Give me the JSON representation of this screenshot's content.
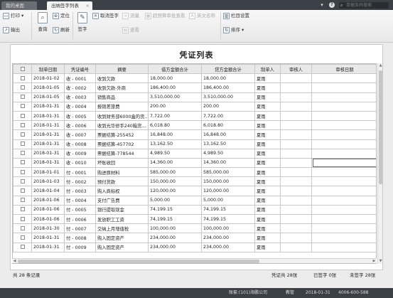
{
  "tabs": {
    "home": "我的桌面",
    "active": "出纳签字列表",
    "close": "×"
  },
  "topbar": {
    "dropdown": "▾",
    "help": "?",
    "search_placeholder": "单据条码搜索"
  },
  "toolbar": {
    "print": "打印",
    "output": "输出",
    "query": "查询",
    "locate": "定位",
    "refresh": "刷新",
    "sign": "签字",
    "cancel_sign": "取消签字",
    "flow": "流量",
    "over_budget": "超预算审批查看",
    "english_name": "英文名称",
    "view": "查看",
    "column_settings": "栏目设置",
    "sort": "排序"
  },
  "document": {
    "title": "凭证列表"
  },
  "columns": [
    "",
    "制单日期",
    "凭证编号",
    "摘要",
    "借方金额合计",
    "贷方金额合计",
    "制单人",
    "审核人",
    "审核日期"
  ],
  "rows": [
    {
      "date": "2018-01-02",
      "no": "收 - 0001",
      "summary": "收到欠款",
      "debit": "18,000.00",
      "credit": "18,000.00",
      "maker": "夏雨"
    },
    {
      "date": "2018-01-05",
      "no": "收 - 0002",
      "summary": "收到欠款-外商",
      "debit": "186,400.00",
      "credit": "186,400.00",
      "maker": "夏雨"
    },
    {
      "date": "2018-01-05",
      "no": "收 - 0003",
      "summary": "销售商品",
      "debit": "3,510,000.00",
      "credit": "3,510,000.00",
      "maker": "夏雨"
    },
    {
      "date": "2018-01-31",
      "no": "收 - 0004",
      "summary": "报销差旅费",
      "debit": "200.00",
      "credit": "200.00",
      "maker": "夏雨"
    },
    {
      "date": "2018-01-31",
      "no": "收 - 0005",
      "summary": "收到财务部6000盒的货...",
      "debit": "7,722.00",
      "credit": "7,722.00",
      "maker": "夏雨"
    },
    {
      "date": "2018-01-31",
      "no": "收 - 0006",
      "summary": "收到光华修手240箱货...",
      "debit": "6,018.80",
      "credit": "6,018.80",
      "maker": "夏雨"
    },
    {
      "date": "2018-01-31",
      "no": "收 - 0007",
      "summary": "票据结算-255452",
      "debit": "16,848.00",
      "credit": "16,848.00",
      "maker": "夏雨"
    },
    {
      "date": "2018-01-31",
      "no": "收 - 0008",
      "summary": "票据结算-457702",
      "debit": "13,162.50",
      "credit": "13,162.50",
      "maker": "夏雨"
    },
    {
      "date": "2018-01-31",
      "no": "收 - 0009",
      "summary": "票据结算-778544",
      "debit": "4,989.50",
      "credit": "4,989.50",
      "maker": "夏雨"
    },
    {
      "date": "2018-01-31",
      "no": "收 - 0010",
      "summary": "坏账收回",
      "debit": "14,360.00",
      "credit": "14,360.00",
      "maker": "夏雨"
    },
    {
      "date": "2018-01-01",
      "no": "付 - 0001",
      "summary": "购进原材料",
      "debit": "585,000.00",
      "credit": "585,000.00",
      "maker": "夏雨"
    },
    {
      "date": "2018-01-03",
      "no": "付 - 0002",
      "summary": "预付货款",
      "debit": "150,000.00",
      "credit": "150,000.00",
      "maker": "夏雨"
    },
    {
      "date": "2018-01-04",
      "no": "付 - 0003",
      "summary": "购入商标权",
      "debit": "120,000.00",
      "credit": "120,000.00",
      "maker": "夏雨"
    },
    {
      "date": "2018-01-06",
      "no": "付 - 0004",
      "summary": "支付广告费",
      "debit": "5,000.00",
      "credit": "5,000.00",
      "maker": "夏雨"
    },
    {
      "date": "2018-01-06",
      "no": "付 - 0005",
      "summary": "银行提取现金",
      "debit": "74,199.15",
      "credit": "74,199.15",
      "maker": "夏雨"
    },
    {
      "date": "2018-01-06",
      "no": "付 - 0006",
      "summary": "发放职工工资",
      "debit": "74,199.15",
      "credit": "74,199.15",
      "maker": "夏雨"
    },
    {
      "date": "2018-01-30",
      "no": "付 - 0007",
      "summary": "交纳上月增值税",
      "debit": "100,000.00",
      "credit": "100,000.00",
      "maker": "夏雨"
    },
    {
      "date": "2018-01-31",
      "no": "付 - 0008",
      "summary": "购入固定资产",
      "debit": "234,000.00",
      "credit": "234,000.00",
      "maker": "夏雨"
    },
    {
      "date": "2018-01-31",
      "no": "付 - 0009",
      "summary": "购入固定资产",
      "debit": "234,000.00",
      "credit": "234,000.00",
      "maker": "夏雨"
    }
  ],
  "summary": {
    "total_records": "共 28 条记录",
    "voucher_total": "凭证共 28张",
    "signed": "已签字 0张",
    "unsigned": "未签字 28张"
  },
  "statusbar": {
    "company": "账套:(101)海鹏公司",
    "user": "教管",
    "date": "2018-01-31",
    "phone": "4006-600-588"
  }
}
